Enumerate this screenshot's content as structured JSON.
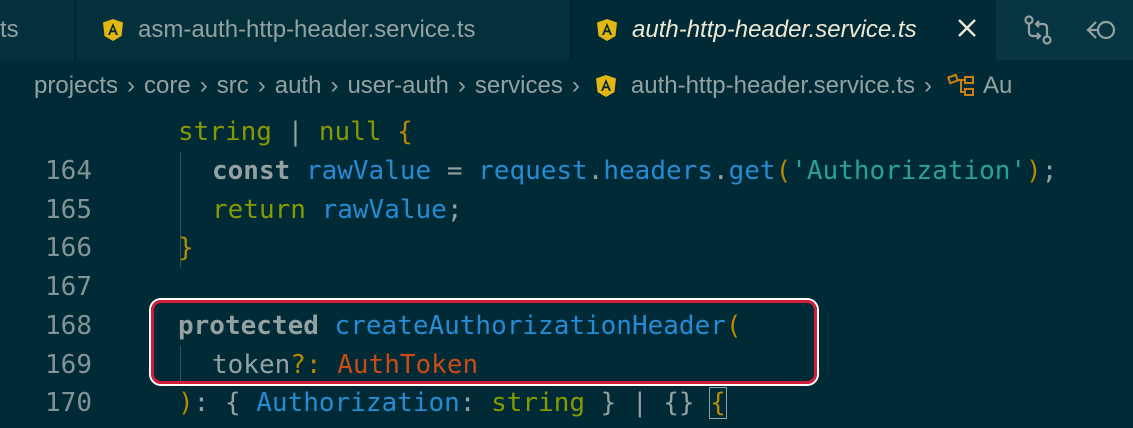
{
  "tabs": [
    {
      "label": "ts",
      "active": false
    },
    {
      "label": "asm-auth-http-header.service.ts",
      "active": false,
      "icon": "angular-icon"
    },
    {
      "label": "auth-http-header.service.ts",
      "active": true,
      "icon": "angular-icon"
    }
  ],
  "breadcrumb": {
    "items": [
      "projects",
      "core",
      "src",
      "auth",
      "user-auth",
      "services",
      "auth-http-header.service.ts",
      "Au"
    ]
  },
  "editor": {
    "lines": [
      {
        "number": "",
        "text": "string | null {"
      },
      {
        "number": "164",
        "text": "const rawValue = request.headers.get('Authorization');"
      },
      {
        "number": "165",
        "text": "return rawValue;"
      },
      {
        "number": "166",
        "text": "}"
      },
      {
        "number": "167",
        "text": ""
      },
      {
        "number": "168",
        "text": "protected createAuthorizationHeader("
      },
      {
        "number": "169",
        "text": "token?: AuthToken"
      },
      {
        "number": "170",
        "text": "): { Authorization: string } | {} {"
      }
    ],
    "tokens": {
      "l0": [
        "string",
        " | ",
        "null",
        " {"
      ],
      "l1": [
        "const",
        " ",
        "rawValue",
        " = ",
        "request",
        ".",
        "headers",
        ".",
        "get",
        "(",
        "'Authorization'",
        ")",
        ";"
      ],
      "l2": [
        "return",
        " ",
        "rawValue",
        ";"
      ],
      "l3": [
        "}"
      ],
      "l5": [
        "protected",
        " ",
        "createAuthorizationHeader",
        "("
      ],
      "l6": [
        "token",
        "?:",
        " ",
        "AuthToken"
      ],
      "l7": [
        ")",
        ": ",
        "{",
        " ",
        "Authorization",
        ": ",
        "string",
        " } | {} ",
        "{"
      ]
    }
  },
  "colors": {
    "background": "#002b36",
    "tabbar": "#073642",
    "highlight": "#d21e3a"
  }
}
